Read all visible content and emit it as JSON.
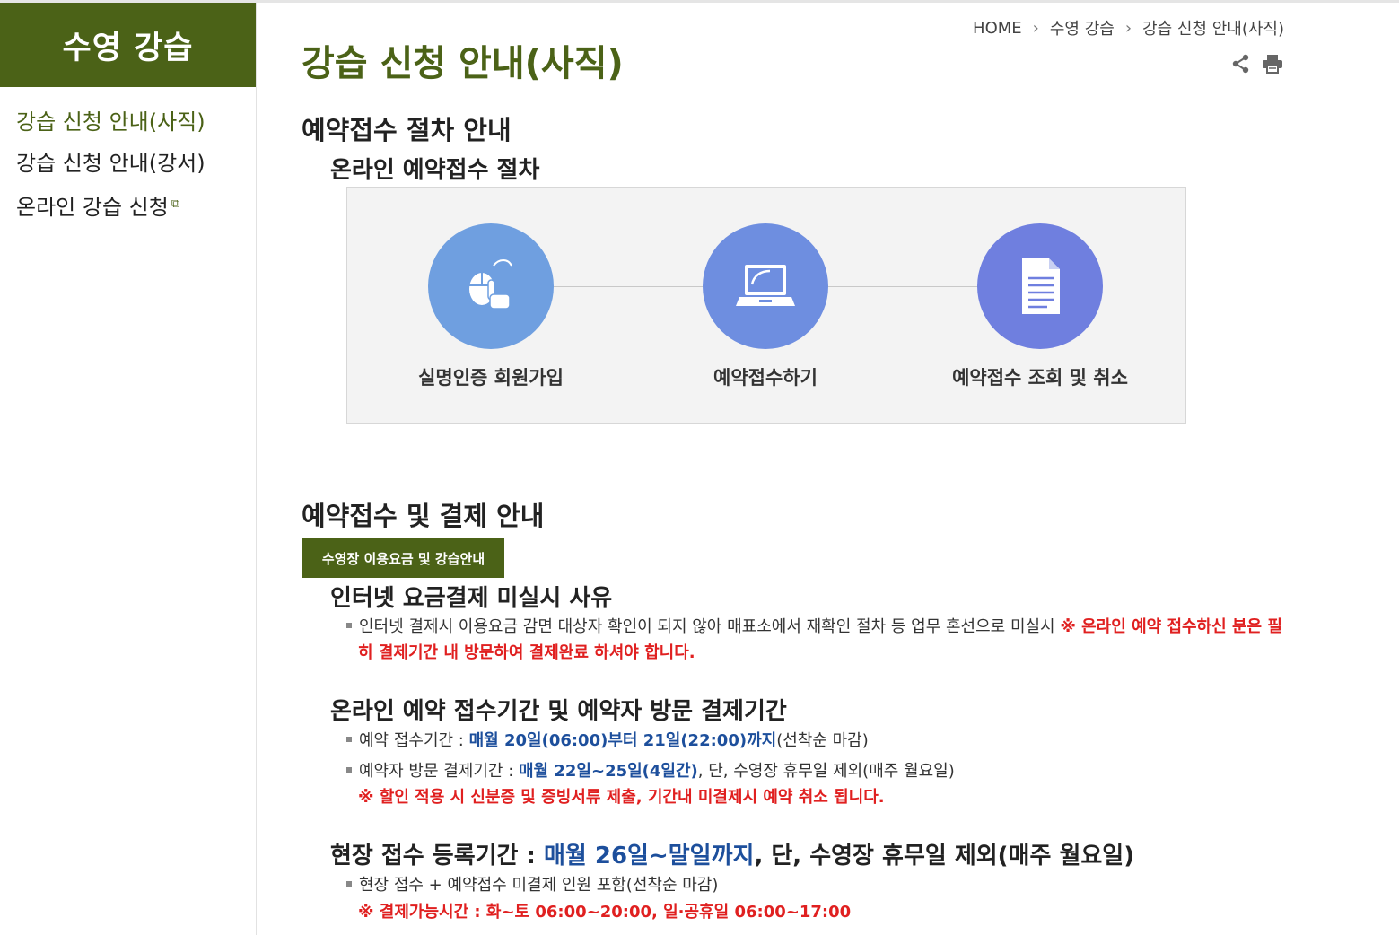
{
  "sidebar": {
    "title": "수영 강습",
    "items": [
      {
        "label": "강습 신청 안내(사직)"
      },
      {
        "label": "강습 신청 안내(강서)"
      },
      {
        "label": "온라인 강습 신청"
      }
    ]
  },
  "breadcrumb": [
    "HOME",
    "수영 강습",
    "강습 신청 안내(사직)"
  ],
  "page_title": "강습 신청 안내(사직)",
  "section1": {
    "heading": "예약접수 절차 안내",
    "subheading": "온라인 예약접수 절차",
    "steps": [
      {
        "label": "실명인증 회원가입",
        "icon": "mouse-click-icon",
        "color": "#6f9fe0"
      },
      {
        "label": "예약접수하기",
        "icon": "laptop-icon",
        "color": "#6e8ee0"
      },
      {
        "label": "예약접수 조회 및 취소",
        "icon": "document-icon",
        "color": "#6f7fdf"
      }
    ]
  },
  "section2": {
    "heading": "예약접수 및 결제 안내",
    "fee_button": "수영장 이용요금 및 강습안내",
    "reason": {
      "title": "인터넷 요금결제 미실시 사유",
      "text": "인터넷 결제시 이용요금 감면 대상자 확인이 되지 않아 매표소에서 재확인 절차 등 업무 혼선으로 미실시",
      "warn_line1": "※ 온라인 예약 접수하신 분은 필",
      "warn_line2": "히 결제기간 내 방문하여 결제완료 하셔야 합니다."
    },
    "period": {
      "title": "온라인 예약 접수기간 및 예약자 방문 결제기간",
      "apply_label": "예약 접수기간 : ",
      "apply_value": "매월 20일(06:00)부터 21일(22:00)까지",
      "apply_tail": "(선착순 마감)",
      "visit_label": "예약자 방문 결제기간 : ",
      "visit_value": "매월 22일~25일(4일간)",
      "visit_tail": ", 단, 수영장 휴무일 제외(매주 월요일)",
      "warn": "※ 할인 적용 시 신분증 및 증빙서류 제출, 기간내 미결제시 예약 취소 됩니다."
    },
    "onsite": {
      "title_label": "현장 접수 등록기간 : ",
      "title_value": "매월 26일~말일까지",
      "title_tail": ", 단, 수영장 휴무일 제외(매주 월요일)",
      "text": "현장 접수 + 예약접수 미결제 인원 포함(선착순 마감)",
      "warn": "※ 결제가능시간 : 화~토 06:00~20:00, 일·공휴일 06:00~17:00"
    }
  },
  "colors": {
    "brand": "#4b6217",
    "blue_text": "#1d4f9c",
    "red_text": "#e02020"
  }
}
